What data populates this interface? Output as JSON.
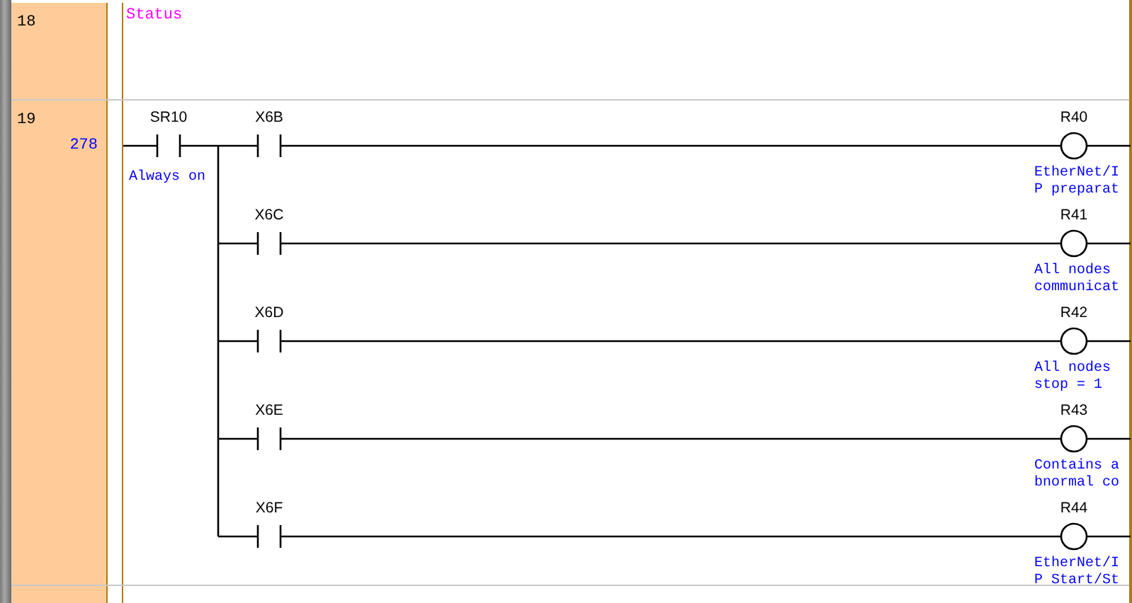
{
  "rows": [
    {
      "number": "18",
      "comment": "Status"
    },
    {
      "number": "19",
      "step": "278",
      "rung": {
        "input": {
          "device": "SR10",
          "comment": "Always on"
        },
        "branches": [
          {
            "contact": "X6B",
            "coil": "R40",
            "coil_comment": [
              "EtherNet/I",
              "P preparat"
            ]
          },
          {
            "contact": "X6C",
            "coil": "R41",
            "coil_comment": [
              "All nodes",
              "communicat"
            ]
          },
          {
            "contact": "X6D",
            "coil": "R42",
            "coil_comment": [
              "All nodes",
              "stop = 1"
            ]
          },
          {
            "contact": "X6E",
            "coil": "R43",
            "coil_comment": [
              "Contains a",
              "bnormal co"
            ]
          },
          {
            "contact": "X6F",
            "coil": "R44",
            "coil_comment": [
              "EtherNet/I",
              "P Start/St"
            ]
          }
        ]
      }
    }
  ]
}
